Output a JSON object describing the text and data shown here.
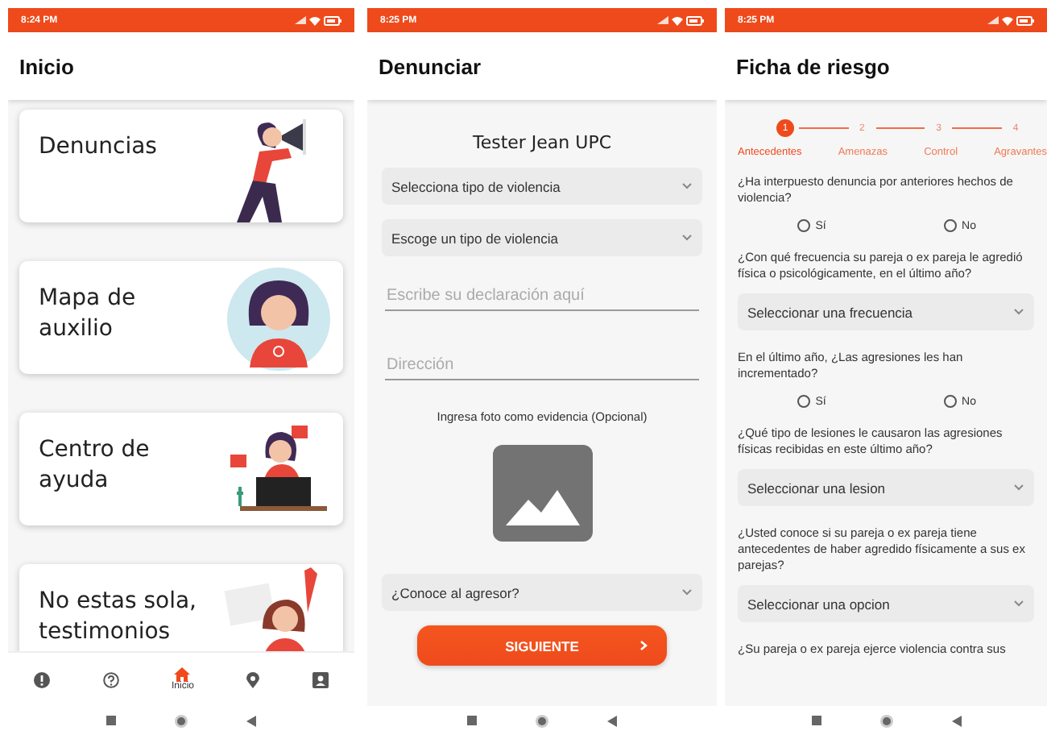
{
  "home": {
    "status_bar": {
      "time": "8:24 PM"
    },
    "title": "Inicio",
    "cards": [
      {
        "label": "Denuncias"
      },
      {
        "label": "Mapa de auxilio"
      },
      {
        "label": "Centro de ayuda"
      },
      {
        "label": "No estas sola, testimonios"
      }
    ],
    "nav": [
      {
        "kind": "info",
        "selected": false
      },
      {
        "kind": "help",
        "selected": false
      },
      {
        "kind": "home",
        "label": "Inicio",
        "selected": true
      },
      {
        "kind": "location",
        "selected": false
      },
      {
        "kind": "contact",
        "selected": false
      }
    ]
  },
  "report": {
    "status_bar": {
      "time": "8:25 PM"
    },
    "title": "Denunciar",
    "user_name": "Tester Jean UPC",
    "fields": [
      {
        "kind": "select",
        "value": "Selecciona tipo de violencia"
      },
      {
        "kind": "select",
        "value": "Escoge un tipo de violencia"
      },
      {
        "kind": "text",
        "placeholder": "Escribe su declaración aquí"
      },
      {
        "kind": "text",
        "placeholder": "Dirección"
      },
      {
        "kind": "photo",
        "label": "Ingresa foto como evidencia (Opcional)"
      },
      {
        "kind": "select",
        "value": "¿Conoce al agresor?"
      }
    ],
    "button": "SIGUIENTE"
  },
  "risk_form": {
    "status_bar": {
      "time": "8:25 PM"
    },
    "title": "Ficha de riesgo",
    "steps": [
      {
        "number": "1",
        "label": "Antecedentes",
        "selected": true
      },
      {
        "number": "2",
        "label": "Amenazas",
        "selected": false
      },
      {
        "number": "3",
        "label": "Control",
        "selected": false
      },
      {
        "number": "4",
        "label": "Agravantes",
        "selected": false
      }
    ],
    "questions": [
      {
        "kind": "radio",
        "question": "¿Ha interpuesto denuncia por anteriores hechos de violencia?",
        "options": [
          {
            "label": "Sí",
            "selected": false
          },
          {
            "label": "No",
            "selected": false
          }
        ]
      },
      {
        "kind": "select",
        "question": "¿Con qué frecuencia su pareja o ex pareja le agredió física o psicológicamente, en el último año?",
        "value": "Seleccionar una frecuencia"
      },
      {
        "kind": "radio",
        "question": "En el último año, ¿Las agresiones les han incrementado?",
        "options": [
          {
            "label": "Sí",
            "selected": false
          },
          {
            "label": "No",
            "selected": false
          }
        ]
      },
      {
        "kind": "select",
        "question": "¿Qué tipo de lesiones le causaron las agresiones físicas recibidas en este último año?",
        "value": "Seleccionar una lesion"
      },
      {
        "kind": "select",
        "question": "¿Usted conoce si su pareja o ex pareja tiene antecedentes de haber agredido físicamente a sus ex parejas?",
        "value": "Seleccionar una opcion"
      },
      {
        "kind": "text",
        "question": "¿Su pareja o ex pareja ejerce violencia contra sus"
      }
    ]
  }
}
